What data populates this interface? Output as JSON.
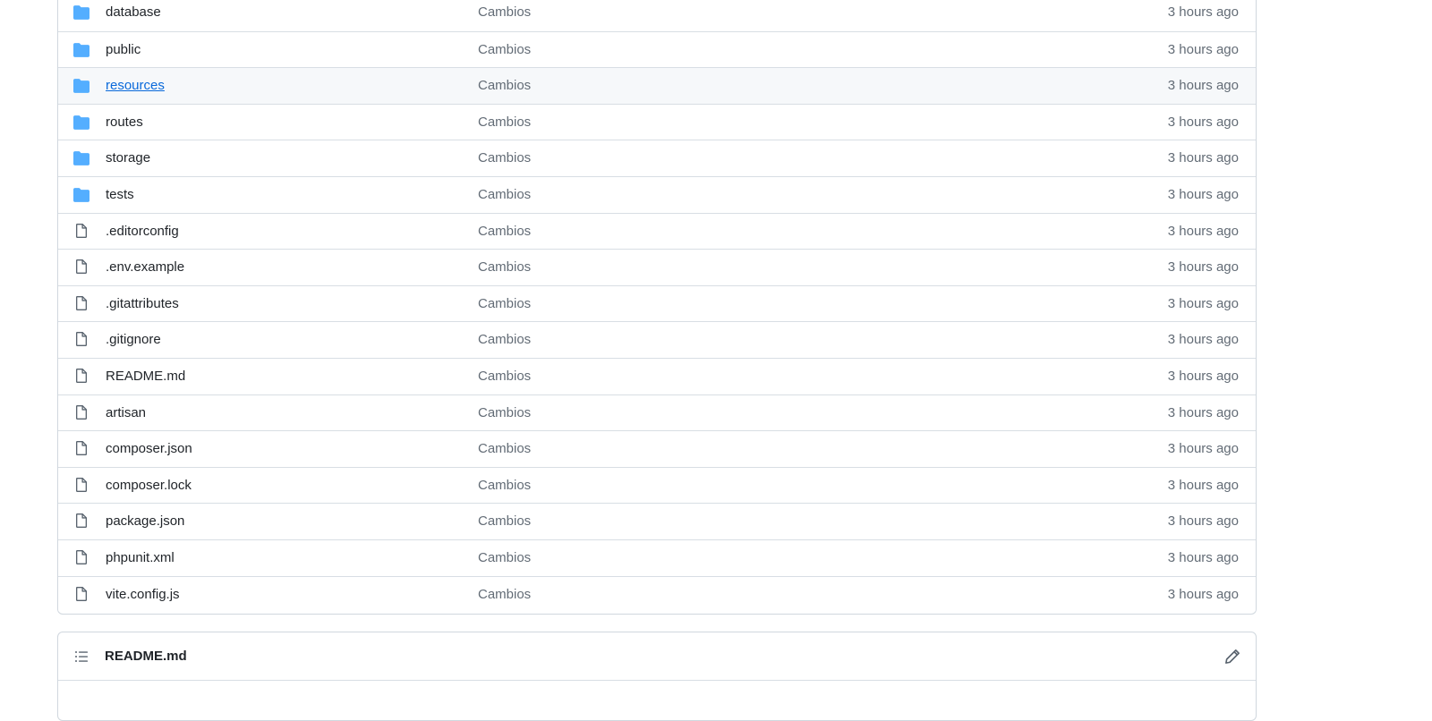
{
  "files": [
    {
      "type": "folder",
      "name": "database",
      "commit": "Cambios",
      "age": "3 hours ago"
    },
    {
      "type": "folder",
      "name": "public",
      "commit": "Cambios",
      "age": "3 hours ago"
    },
    {
      "type": "folder",
      "name": "resources",
      "commit": "Cambios",
      "age": "3 hours ago",
      "hovered": true
    },
    {
      "type": "folder",
      "name": "routes",
      "commit": "Cambios",
      "age": "3 hours ago"
    },
    {
      "type": "folder",
      "name": "storage",
      "commit": "Cambios",
      "age": "3 hours ago"
    },
    {
      "type": "folder",
      "name": "tests",
      "commit": "Cambios",
      "age": "3 hours ago"
    },
    {
      "type": "file",
      "name": ".editorconfig",
      "commit": "Cambios",
      "age": "3 hours ago"
    },
    {
      "type": "file",
      "name": ".env.example",
      "commit": "Cambios",
      "age": "3 hours ago"
    },
    {
      "type": "file",
      "name": ".gitattributes",
      "commit": "Cambios",
      "age": "3 hours ago"
    },
    {
      "type": "file",
      "name": ".gitignore",
      "commit": "Cambios",
      "age": "3 hours ago"
    },
    {
      "type": "file",
      "name": "README.md",
      "commit": "Cambios",
      "age": "3 hours ago"
    },
    {
      "type": "file",
      "name": "artisan",
      "commit": "Cambios",
      "age": "3 hours ago"
    },
    {
      "type": "file",
      "name": "composer.json",
      "commit": "Cambios",
      "age": "3 hours ago"
    },
    {
      "type": "file",
      "name": "composer.lock",
      "commit": "Cambios",
      "age": "3 hours ago"
    },
    {
      "type": "file",
      "name": "package.json",
      "commit": "Cambios",
      "age": "3 hours ago"
    },
    {
      "type": "file",
      "name": "phpunit.xml",
      "commit": "Cambios",
      "age": "3 hours ago"
    },
    {
      "type": "file",
      "name": "vite.config.js",
      "commit": "Cambios",
      "age": "3 hours ago"
    }
  ],
  "readme": {
    "title": "README.md",
    "list_icon": "list-unordered-icon",
    "edit_icon": "pencil-icon"
  },
  "colors": {
    "folder": "#54aeff",
    "file_icon": "#59636e",
    "link": "#0969da",
    "border": "#d0d7de",
    "hover_bg": "#f6f8fa"
  }
}
